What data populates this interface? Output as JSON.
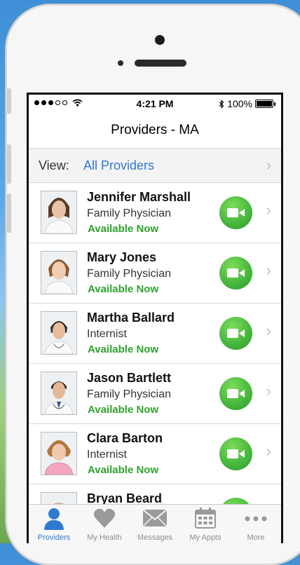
{
  "status": {
    "time": "4:21 PM",
    "battery": "100%",
    "carrier_signal": "signal-dots",
    "wifi_icon": "wifi-icon",
    "bluetooth_icon": "bluetooth-icon"
  },
  "header": {
    "title": "Providers - MA"
  },
  "view": {
    "label": "View:",
    "value": "All Providers"
  },
  "providers": [
    {
      "name": "Jennifer Marshall",
      "specialty": "Family Physician",
      "status": "Available Now"
    },
    {
      "name": "Mary Jones",
      "specialty": "Family Physician",
      "status": "Available Now"
    },
    {
      "name": "Martha Ballard",
      "specialty": "Internist",
      "status": "Available Now"
    },
    {
      "name": "Jason Bartlett",
      "specialty": "Family Physician",
      "status": "Available Now"
    },
    {
      "name": "Clara Barton",
      "specialty": "Internist",
      "status": "Available Now"
    },
    {
      "name": "Bryan Beard",
      "specialty": "",
      "status": ""
    }
  ],
  "tabs": [
    {
      "label": "Providers",
      "icon": "person-icon",
      "active": true
    },
    {
      "label": "My Health",
      "icon": "heart-icon",
      "active": false
    },
    {
      "label": "Messages",
      "icon": "envelope-icon",
      "active": false
    },
    {
      "label": "My Appts",
      "icon": "calendar-icon",
      "active": false
    },
    {
      "label": "More",
      "icon": "more-dots-icon",
      "active": false
    }
  ],
  "colors": {
    "accent": "#2f7ad0",
    "available": "#2ea32e",
    "video_button": "#45b53c"
  }
}
